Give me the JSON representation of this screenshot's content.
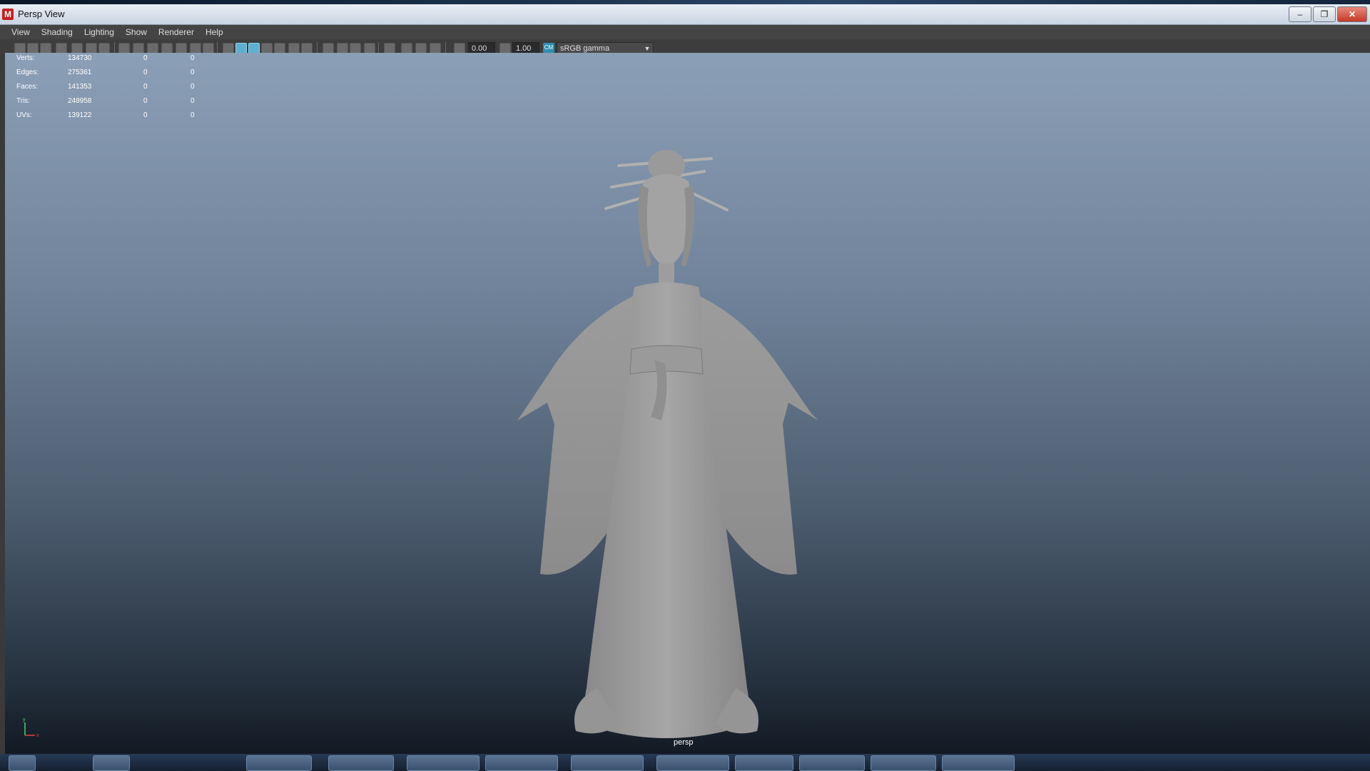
{
  "window": {
    "title": "Persp View"
  },
  "window_controls": {
    "minimize": "–",
    "maximize": "❐",
    "close": "✕"
  },
  "menu": [
    "View",
    "Shading",
    "Lighting",
    "Show",
    "Renderer",
    "Help"
  ],
  "toolbar": {
    "field_one": "0.00",
    "field_two": "1.00",
    "color_management_badge": "CM",
    "color_space": "sRGB gamma"
  },
  "hud": {
    "rows": [
      {
        "label": "Verts:",
        "total": "134730",
        "selected": "0",
        "component": "0"
      },
      {
        "label": "Edges:",
        "total": "275361",
        "selected": "0",
        "component": "0"
      },
      {
        "label": "Faces:",
        "total": "141353",
        "selected": "0",
        "component": "0"
      },
      {
        "label": "Tris:",
        "total": "248958",
        "selected": "0",
        "component": "0"
      },
      {
        "label": "UVs:",
        "total": "139122",
        "selected": "0",
        "component": "0"
      }
    ]
  },
  "viewport": {
    "camera_label": "persp",
    "axis_y": "y",
    "axis_x": "x"
  },
  "colors": {
    "viewport_top": "#8b9fb6",
    "viewport_bottom": "#121a23",
    "model_gray": "#9a9a9a",
    "active_button": "#5fb0d0",
    "axis_x": "#e04040",
    "axis_y": "#50d070"
  }
}
